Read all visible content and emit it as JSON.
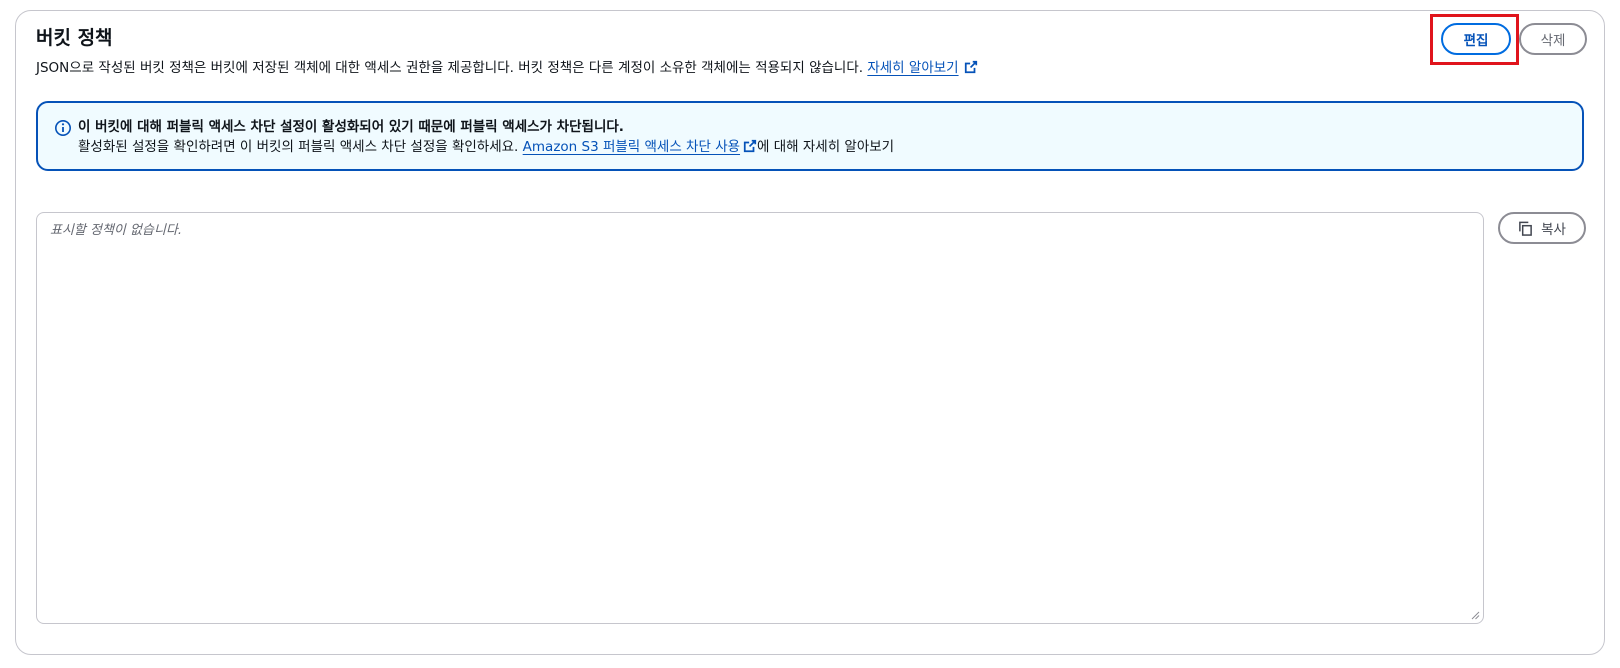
{
  "section": {
    "title": "버킷 정책",
    "description": "JSON으로 작성된 버킷 정책은 버킷에 저장된 객체에 대한 액세스 권한을 제공합니다. 버킷 정책은 다른 계정이 소유한 객체에는 적용되지 않습니다.",
    "learn_more_link": "자세히 알아보기"
  },
  "actions": {
    "edit_label": "편집",
    "delete_label": "삭제",
    "copy_label": "복사"
  },
  "alert": {
    "title": "이 버킷에 대해 퍼블릭 액세스 차단 설정이 활성화되어 있기 때문에 퍼블릭 액세스가 차단됩니다.",
    "body_prefix": "활성화된 설정을 확인하려면 이 버킷의 퍼블릭 액세스 차단 설정을 확인하세요.",
    "link_text": "Amazon S3 퍼블릭 액세스 차단 사용",
    "body_suffix": "에 대해 자세히 알아보기"
  },
  "policy": {
    "placeholder": "표시할 정책이 없습니다."
  },
  "icons": {
    "info": "info-icon",
    "external_link": "external-link-icon",
    "copy": "copy-icon"
  },
  "colors": {
    "link": "#0552b8",
    "primary_border": "#006ce0",
    "alert_background": "#f0fbff",
    "highlight": "#e0141c"
  }
}
